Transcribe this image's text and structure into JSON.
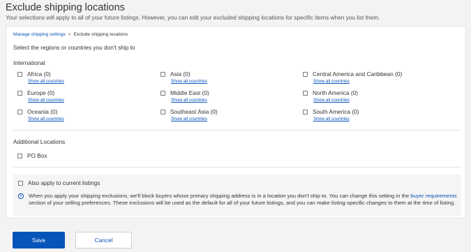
{
  "header": {
    "title": "Exclude shipping locations",
    "subtitle": "Your selections will apply to all of your future listings. However, you can edit your excluded shipping locations for specific items when you list them."
  },
  "breadcrumb": {
    "link": "Manage shipping settings",
    "separator": ">",
    "current": "Exclude shipping locations"
  },
  "instruction": "Select the regions or countries you don't ship to",
  "international": {
    "title": "International",
    "show_all_label": "Show all countries",
    "regions": [
      {
        "label": "Africa (0)",
        "checked": false
      },
      {
        "label": "Asia (0)",
        "checked": false
      },
      {
        "label": "Central America and Caribbean (0)",
        "checked": false
      },
      {
        "label": "Europe (0)",
        "checked": false
      },
      {
        "label": "Middle East (0)",
        "checked": false
      },
      {
        "label": "North America (0)",
        "checked": false
      },
      {
        "label": "Oceania (0)",
        "checked": false
      },
      {
        "label": "Southeast Asia (0)",
        "checked": false
      },
      {
        "label": "South America (0)",
        "checked": false
      }
    ]
  },
  "additional": {
    "title": "Additional Locations",
    "po_box_label": "PO Box"
  },
  "apply": {
    "label": "Also apply to current listings",
    "info_before": "When you apply your shipping exclusions, we'll block buyers whose primary shipping address is in a location you don't ship to. You can change this setting in the ",
    "info_link": "buyer requirements",
    "info_after": " section of your selling preferences. These exclusions will be used as the default for all of your future listings, and you can make listing-specific changes to them at the time of listing."
  },
  "buttons": {
    "save": "Save",
    "cancel": "Cancel"
  },
  "colors": {
    "accent": "#0654ba",
    "background": "#f3f3f3"
  }
}
